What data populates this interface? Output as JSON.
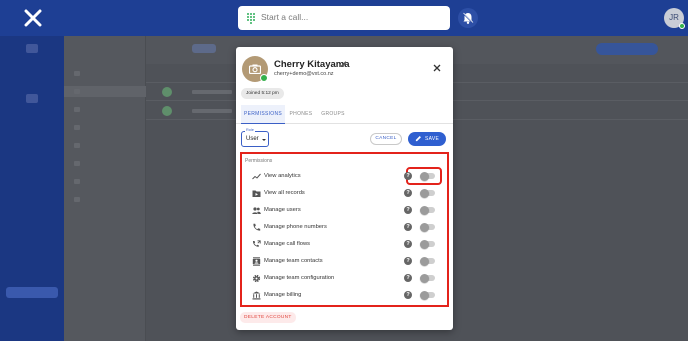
{
  "topbar": {
    "search_placeholder": "Start a call...",
    "avatar_initials": "JR"
  },
  "user": {
    "name": "Cherry Kitayama",
    "email": "cherry+demo@vxt.co.nz",
    "joined": "Joined 5:12 pm"
  },
  "tabs": [
    {
      "label": "PERMISSIONS",
      "active": true
    },
    {
      "label": "PHONES",
      "active": false
    },
    {
      "label": "GROUPS",
      "active": false
    }
  ],
  "role": {
    "label": "Role",
    "value": "User"
  },
  "actions": {
    "cancel": "CANCEL",
    "save": "SAVE",
    "delete": "DELETE ACCOUNT"
  },
  "permissions": {
    "heading": "Permissions",
    "items": [
      {
        "label": "View analytics",
        "icon": "trend-line-icon",
        "enabled": false
      },
      {
        "label": "View all records",
        "icon": "folder-record-icon",
        "enabled": false
      },
      {
        "label": "Manage users",
        "icon": "people-icon",
        "enabled": false
      },
      {
        "label": "Manage phone numbers",
        "icon": "phone-icon",
        "enabled": false
      },
      {
        "label": "Manage call flows",
        "icon": "call-flow-icon",
        "enabled": false
      },
      {
        "label": "Manage team contacts",
        "icon": "contacts-icon",
        "enabled": false
      },
      {
        "label": "Manage team configuration",
        "icon": "gear-icon",
        "enabled": false
      },
      {
        "label": "Manage billing",
        "icon": "bank-icon",
        "enabled": false
      }
    ]
  },
  "colors": {
    "brand_blue": "#1e3f94",
    "accent": "#2f5fd0",
    "highlight_red": "#e3231b"
  }
}
